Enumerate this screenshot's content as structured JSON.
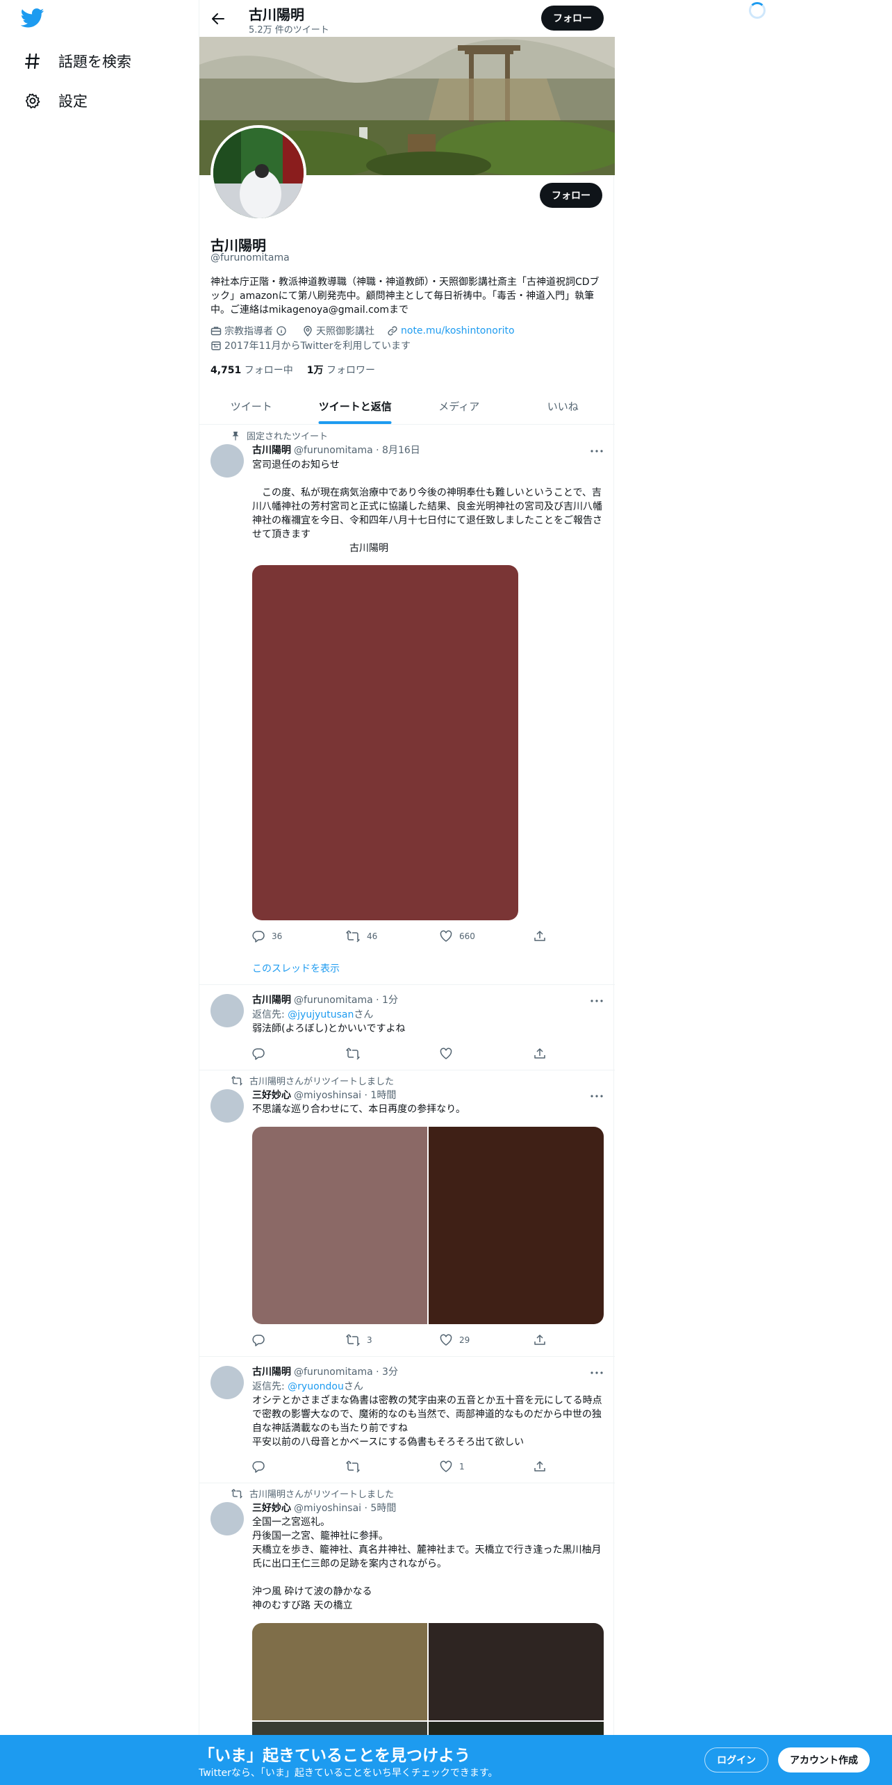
{
  "sidebar": {
    "items": [
      {
        "label": "話題を検索",
        "icon": "hashtag-icon"
      },
      {
        "label": "設定",
        "icon": "gear-icon"
      }
    ]
  },
  "header": {
    "name": "古川陽明",
    "tweet_count": "5.2万 件のツイート",
    "follow_label": "フォロー"
  },
  "profile": {
    "name": "古川陽明",
    "handle": "@furunomitama",
    "follow_label": "フォロー",
    "bio": "神社本庁正階・教派神道教導職（神職・神道教師）・天照御影講社斎主「古神道祝詞CDブック」amazonにて第八刷発売中。顧問神主として毎日祈祷中。「毒舌・神道入門」執筆中。ご連絡はmikagenoya@gmail.comまで",
    "category": "宗教指導者",
    "location": "天照御影講社",
    "url": "note.mu/koshintonorito",
    "joined": "2017年11月からTwitterを利用しています",
    "following_count": "4,751",
    "following_label": "フォロー中",
    "followers_count": "1万",
    "followers_label": "フォロワー"
  },
  "tabs": [
    {
      "label": "ツイート",
      "active": false
    },
    {
      "label": "ツイートと返信",
      "active": true
    },
    {
      "label": "メディア",
      "active": false
    },
    {
      "label": "いいね",
      "active": false
    }
  ],
  "tweets": [
    {
      "social": "固定されたツイート",
      "name": "古川陽明",
      "handle_time": "@furunomitama · 8月16日",
      "text": "宮司退任のお知らせ\n\n　この度、私が現在病気治療中であり今後の神明奉仕も難しいということで、吉川八幡神社の芳村宮司と正式に協議した結果、良金光明神社の宮司及び吉川八幡神社の権禰宜を今日、令和四年八月十七日付にて退任致しましたことをご報告させて頂きます\n　　　　　　　　　　古川陽明",
      "replies": "36",
      "retweets": "46",
      "likes": "660",
      "show_thread": "このスレッドを表示",
      "media_color": "#7a3535"
    },
    {
      "name": "古川陽明",
      "handle_time": "@furunomitama · 1分",
      "reply_prefix": "返信先: ",
      "reply_to": "@jyujyutusan",
      "reply_suffix": "さん",
      "text": "弱法師(よろぼし)とかいいですよね",
      "replies": "",
      "retweets": "",
      "likes": ""
    },
    {
      "social": "古川陽明さんがリツイートしました",
      "name": "三好妙心",
      "handle_time": "@miyoshinsai · 1時間",
      "text": "不思議な巡り合わせにて、本日再度の参拝なり。",
      "replies": "",
      "retweets": "3",
      "likes": "29",
      "media_colors": [
        "#8b6966",
        "#3f2016"
      ]
    },
    {
      "name": "古川陽明",
      "handle_time": "@furunomitama · 3分",
      "reply_prefix": "返信先: ",
      "reply_to": "@ryuondou",
      "reply_suffix": "さん",
      "text": "オシテとかさまざまな偽書は密教の梵字由来の五音とか五十音を元にしてる時点で密教の影響大なので、魔術的なのも当然で、両部神道的なものだから中世の独自な神話満載なのも当たり前ですね\n平安以前の八母音とかベースにする偽書もそろそろ出て欲しい",
      "replies": "",
      "retweets": "",
      "likes": "1"
    },
    {
      "social": "古川陽明さんがリツイートしました",
      "name": "三好妙心",
      "handle_time": "@miyoshinsai · 5時間",
      "text": "全国一之宮巡礼。\n丹後国一之宮、籠神社に参拝。\n天橋立を歩き、籠神社、真名井神社、麓神社まで。天橋立で行き逢った黒川柚月氏に出口王仁三郎の足跡を案内されながら。\n\n沖つ風 砕けて波の静かなる\n神のむすび路 天の橋立",
      "media_colors": [
        "#7f6e49",
        "#2e2522",
        "#3a3c33",
        "#22261c"
      ]
    }
  ],
  "bottom_bar": {
    "title": "「いま」起きていることを見つけよう",
    "subtitle": "Twitterなら、「いま」起きていることをいち早くチェックできます。",
    "login": "ログイン",
    "signup": "アカウント作成"
  },
  "colors": {
    "accent": "#1d9bf0",
    "text": "#0f1419",
    "muted": "#536471"
  }
}
